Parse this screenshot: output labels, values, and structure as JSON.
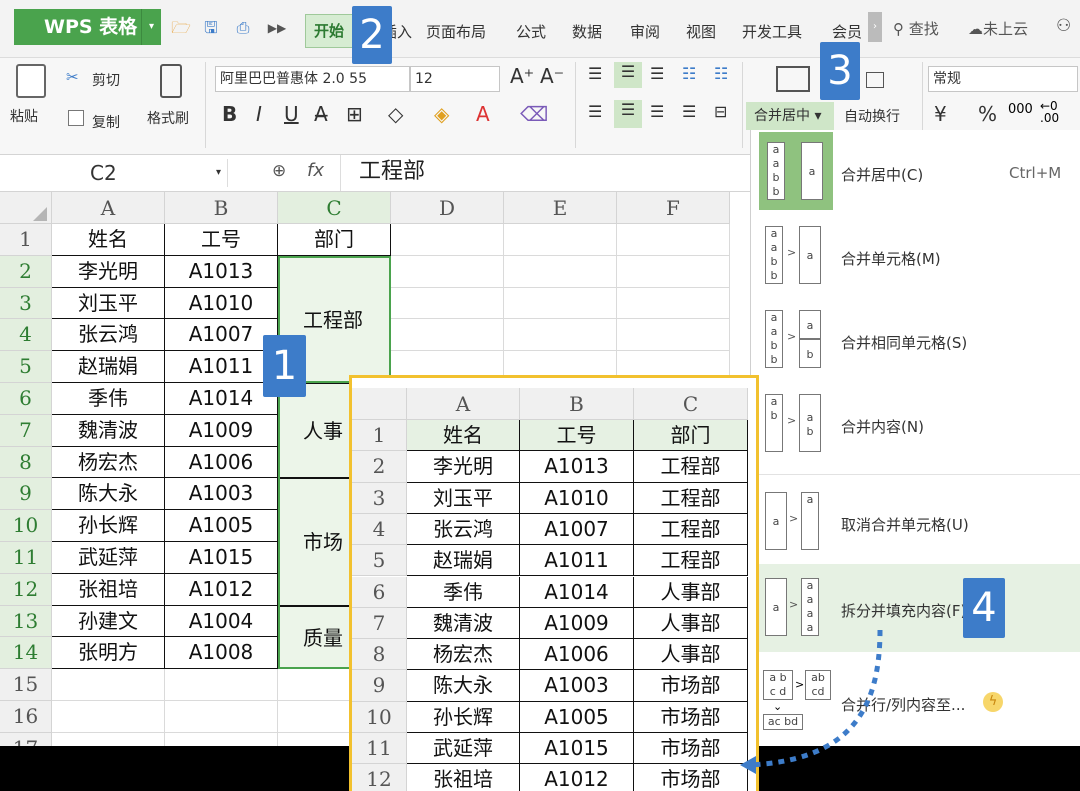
{
  "app": {
    "title": "WPS 表格",
    "search": "查找",
    "cloud": "未上云"
  },
  "menu": [
    "开始",
    "插入",
    "页面布局",
    "公式",
    "数据",
    "审阅",
    "视图",
    "开发工具",
    "会员"
  ],
  "ribbon": {
    "paste": "粘贴",
    "cut": "剪切",
    "copy": "复制",
    "format_painter": "格式刷",
    "font_name": "阿里巴巴普惠体 2.0 55",
    "font_size": "12",
    "merge_center": "合并居中",
    "wrap_text": "自动换行",
    "number_format": "常规",
    "currency": "¥",
    "percent": "%",
    "thousands": "000"
  },
  "formula_bar": {
    "cell_ref": "C2",
    "fx": "fx",
    "value": "工程部"
  },
  "sheet": {
    "columns": [
      "A",
      "B",
      "C",
      "D",
      "E",
      "F"
    ],
    "rows": [
      "1",
      "2",
      "3",
      "4",
      "5",
      "6",
      "7",
      "8",
      "9",
      "10",
      "11",
      "12",
      "13",
      "14",
      "15",
      "16",
      "17"
    ],
    "header": [
      "姓名",
      "工号",
      "部门"
    ],
    "names": [
      "李光明",
      "刘玉平",
      "张云鸿",
      "赵瑞娟",
      "季伟",
      "魏清波",
      "杨宏杰",
      "陈大永",
      "孙长辉",
      "武延萍",
      "张祖培",
      "孙建文",
      "张明方"
    ],
    "ids": [
      "A1013",
      "A1010",
      "A1007",
      "A1011",
      "A1014",
      "A1009",
      "A1006",
      "A1003",
      "A1005",
      "A1015",
      "A1012",
      "A1004",
      "A1008"
    ],
    "merged": [
      "工程部",
      "人事",
      "市场",
      "质量"
    ]
  },
  "dropdown": {
    "items": [
      {
        "label": "合并居中(C)",
        "shortcut": "Ctrl+M"
      },
      {
        "label": "合并单元格(M)"
      },
      {
        "label": "合并相同单元格(S)"
      },
      {
        "label": "合并内容(N)"
      },
      {
        "label": "取消合并单元格(U)"
      },
      {
        "label": "拆分并填充内容(F)"
      },
      {
        "label": "合并行/列内容至..."
      }
    ]
  },
  "inset": {
    "columns": [
      "A",
      "B",
      "C"
    ],
    "rows": [
      "1",
      "2",
      "3",
      "4",
      "5",
      "6",
      "7",
      "8",
      "9",
      "10",
      "11",
      "12"
    ],
    "header": [
      "姓名",
      "工号",
      "部门"
    ],
    "names": [
      "李光明",
      "刘玉平",
      "张云鸿",
      "赵瑞娟",
      "季伟",
      "魏清波",
      "杨宏杰",
      "陈大永",
      "孙长辉",
      "武延萍",
      "张祖培"
    ],
    "ids": [
      "A1013",
      "A1010",
      "A1007",
      "A1011",
      "A1014",
      "A1009",
      "A1006",
      "A1003",
      "A1005",
      "A1015",
      "A1012"
    ],
    "depts": [
      "工程部",
      "工程部",
      "工程部",
      "工程部",
      "人事部",
      "人事部",
      "人事部",
      "市场部",
      "市场部",
      "市场部",
      "市场部"
    ]
  },
  "badges": [
    "1",
    "2",
    "3",
    "4"
  ],
  "colors": {
    "accent_green": "#4aa34d",
    "badge_blue": "#3d7cc9",
    "inset_border": "#f2c12e"
  }
}
